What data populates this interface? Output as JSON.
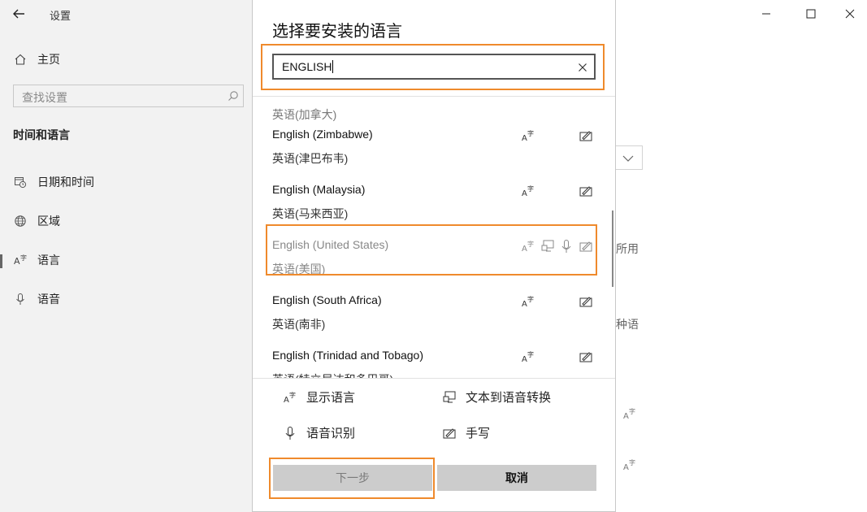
{
  "settings": {
    "app_title": "设置",
    "nav_home": "主页",
    "search_placeholder": "查找设置",
    "section_title": "时间和语言",
    "nav_items": [
      "日期和时间",
      "区域",
      "语言",
      "语音"
    ],
    "selected_nav": "语言",
    "right_fragments": [
      "所用",
      "种语"
    ]
  },
  "dialog": {
    "title": "选择要安装的语言",
    "search_value": "ENGLISH",
    "partial_top_item": "英语(加拿大)",
    "languages": [
      {
        "name": "English (Zimbabwe)",
        "native": "英语(津巴布韦)",
        "features": [
          "display-language",
          "handwriting"
        ],
        "dim": false
      },
      {
        "name": "English (Malaysia)",
        "native": "英语(马来西亚)",
        "features": [
          "display-language",
          "handwriting"
        ],
        "dim": false
      },
      {
        "name": "English (United States)",
        "native": "英语(美国)",
        "features": [
          "display-language",
          "text-to-speech",
          "speech-recognition",
          "handwriting"
        ],
        "dim": true
      },
      {
        "name": "English (South Africa)",
        "native": "英语(南非)",
        "features": [
          "display-language",
          "handwriting"
        ],
        "dim": false
      },
      {
        "name": "English (Trinidad and Tobago)",
        "native": "英语(特立尼达和多巴哥)",
        "features": [
          "display-language",
          "handwriting"
        ],
        "dim": false
      }
    ],
    "legend": {
      "display_language": "显示语言",
      "text_to_speech": "文本到语音转换",
      "speech_recognition": "语音识别",
      "handwriting": "手写"
    },
    "next_button": "下一步",
    "cancel_button": "取消"
  },
  "colors": {
    "highlight": "#ef8a2c",
    "sidebar_bg": "#f2f2f2",
    "button_bg": "#cccccc"
  }
}
